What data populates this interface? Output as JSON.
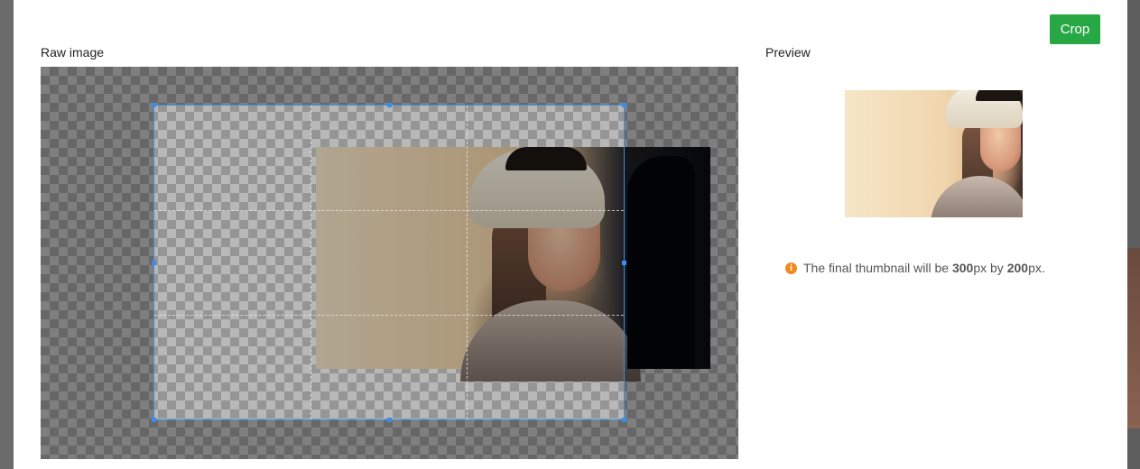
{
  "toolbar": {
    "crop_label": "Crop"
  },
  "raw_section": {
    "label": "Raw image"
  },
  "preview_section": {
    "label": "Preview"
  },
  "note": {
    "icon": "info-icon",
    "prefix": "The final thumbnail will be ",
    "width_value": "300",
    "unit1": "px by ",
    "height_value": "200",
    "unit2": "px."
  },
  "colors": {
    "accent": "#28a745",
    "selection": "#3b8ee8",
    "info": "#f0891d"
  }
}
